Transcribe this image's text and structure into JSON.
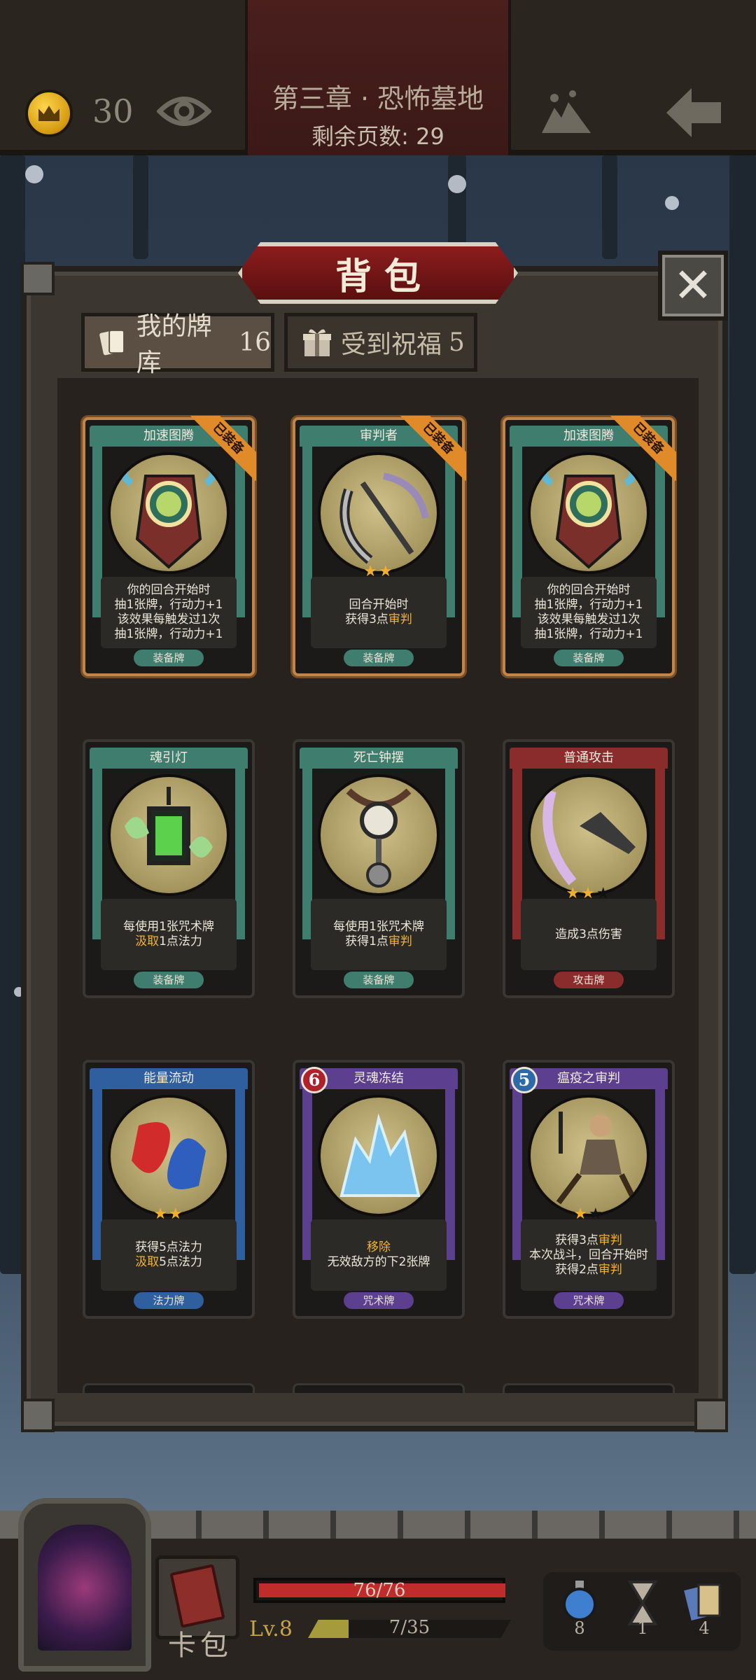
{
  "topbar": {
    "gold": "30",
    "chapter": "第三章 · 恐怖墓地",
    "pages_remaining": "剩余页数: 29",
    "icons": [
      "crown-coin-icon",
      "eye-icon",
      "map-icon",
      "back-arrow-icon"
    ]
  },
  "dialog": {
    "title": "背包",
    "close": "✕"
  },
  "tabs": [
    {
      "label": "我的牌库",
      "count": "16",
      "icon": "cards-icon",
      "active": true
    },
    {
      "label": "受到祝福",
      "count": "5",
      "icon": "gift-icon",
      "active": false
    }
  ],
  "cards": [
    {
      "name": "加速图腾",
      "badge": "已装备",
      "lines": [
        "你的回合开始时",
        "抽1张牌，行动力+1",
        "该效果每触发过1次",
        "抽1张牌，行动力+1"
      ],
      "type": "装备牌",
      "theme": "green"
    },
    {
      "name": "审判者",
      "badge": "已装备",
      "stars": "★★",
      "lines": [
        "回合开始时"
      ],
      "hl_prefix": "获得3点",
      "hl": "审判",
      "type": "装备牌",
      "theme": "green"
    },
    {
      "name": "加速图腾",
      "badge": "已装备",
      "lines": [
        "你的回合开始时",
        "抽1张牌，行动力+1",
        "该效果每触发过1次",
        "抽1张牌，行动力+1"
      ],
      "type": "装备牌",
      "theme": "green"
    },
    {
      "name": "魂引灯",
      "lines": [
        "每使用1张咒术牌"
      ],
      "hl": "汲取",
      "hl_suffix": "1点法力",
      "type": "装备牌",
      "theme": "green"
    },
    {
      "name": "死亡钟摆",
      "lines": [
        "每使用1张咒术牌"
      ],
      "hl_prefix": "获得1点",
      "hl": "审判",
      "type": "装备牌",
      "theme": "green"
    },
    {
      "name": "普通攻击",
      "stars": "★★",
      "stars_off": "★",
      "lines": [
        "造成3点伤害"
      ],
      "type": "攻击牌",
      "theme": "red"
    },
    {
      "name": "能量流动",
      "stars": "★★",
      "lines": [
        "获得5点法力"
      ],
      "hl": "汲取",
      "hl_suffix": "5点法力",
      "type": "法力牌",
      "theme": "blue"
    },
    {
      "name": "灵魂冻结",
      "cost": "6",
      "hl": "移除",
      "lines2": [
        "无效敌方的下2张牌"
      ],
      "type": "咒术牌",
      "theme": "purple"
    },
    {
      "name": "瘟疫之审判",
      "cost": "5",
      "stars": "★",
      "stars_off": "★",
      "hl_prefix": "获得3点",
      "hl": "审判",
      "lines": [
        "本次战斗，回合开始时"
      ],
      "hl2_prefix": "获得2点",
      "hl2": "审判",
      "type": "咒术牌",
      "theme": "purple"
    }
  ],
  "hud": {
    "deck_label": "卡包",
    "hp": "76/76",
    "hp_fraction": 1.0,
    "level": "Lv.8",
    "xp": "7/35",
    "xp_fraction": 0.2,
    "items": [
      {
        "icon": "potion-icon",
        "value": "8"
      },
      {
        "icon": "hourglass-icon",
        "value": "1"
      },
      {
        "icon": "cards-stack-icon",
        "value": "4"
      }
    ]
  },
  "colors": {
    "green": "#3f7d6e",
    "red": "#8b2c2c",
    "blue": "#2f5f9e",
    "purple": "#5c3f8e",
    "highlight": "#f2b333"
  }
}
